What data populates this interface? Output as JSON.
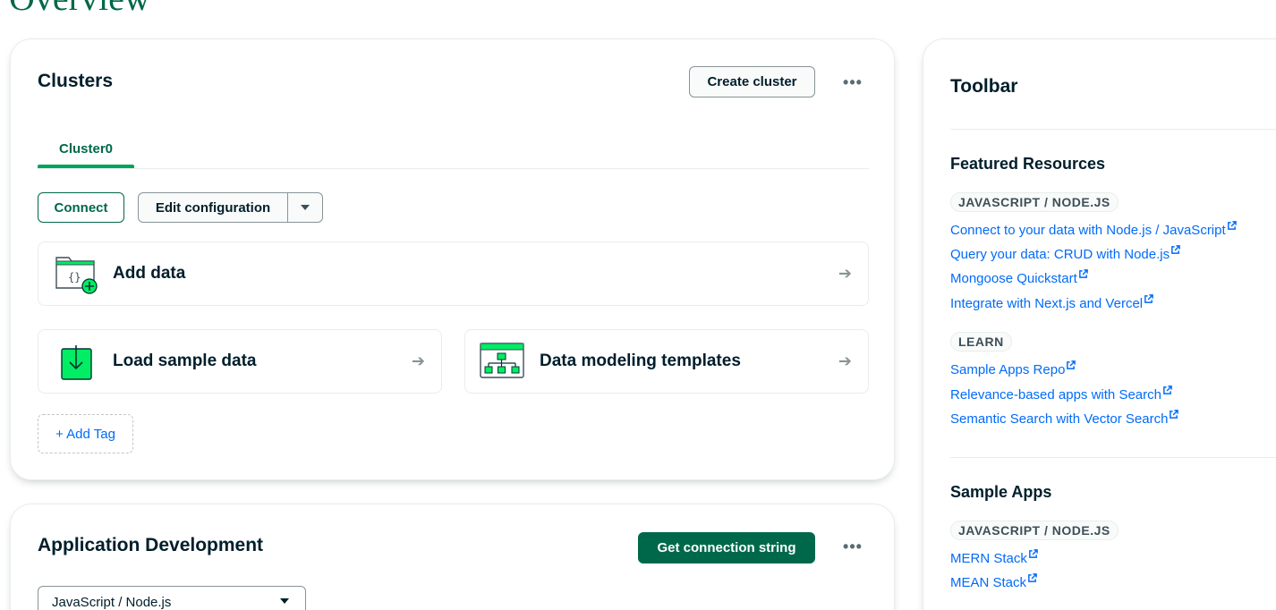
{
  "page": {
    "title": "Overview"
  },
  "clusters": {
    "heading": "Clusters",
    "create_label": "Create cluster",
    "more_label": "•••",
    "tab": "Cluster0",
    "connect_label": "Connect",
    "edit_label": "Edit configuration",
    "tiles": {
      "add_data": "Add data",
      "load_sample": "Load sample data",
      "data_modeling": "Data modeling templates"
    },
    "arrow": "➔",
    "add_tag": "+ Add Tag"
  },
  "app_dev": {
    "heading": "Application Development",
    "get_conn_label": "Get connection string",
    "more_label": "•••",
    "select_value": "JavaScript / Node.js"
  },
  "toolbar": {
    "heading": "Toolbar",
    "featured": {
      "title": "Featured Resources",
      "badge_js": "JAVASCRIPT / NODE.JS",
      "links_js": [
        "Connect to your data with Node.js / JavaScript",
        "Query your data: CRUD with Node.js",
        "Mongoose Quickstart",
        "Integrate with Next.js and Vercel"
      ],
      "badge_learn": "LEARN",
      "links_learn": [
        "Sample Apps Repo",
        "Relevance-based apps with Search",
        "Semantic Search with Vector Search"
      ]
    },
    "sample_apps": {
      "title": "Sample Apps",
      "badge": "JAVASCRIPT / NODE.JS",
      "links": [
        "MERN Stack",
        "MEAN Stack"
      ]
    }
  },
  "colors": {
    "brand_green": "#00684a",
    "accent_green": "#00a35c",
    "link_blue": "#016bf8",
    "text_dark": "#001e2b"
  }
}
